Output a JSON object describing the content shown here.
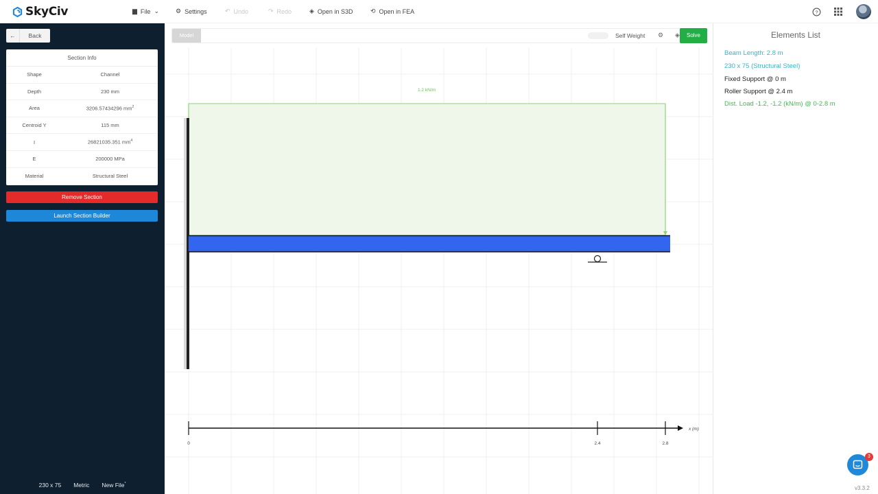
{
  "app": {
    "name": "SkyCiv",
    "version": "v3.3.2"
  },
  "topbar": {
    "file": "File",
    "settings": "Settings",
    "undo": "Undo",
    "redo": "Redo",
    "open_s3d": "Open in S3D",
    "open_fea": "Open in FEA"
  },
  "sidebar": {
    "back": "Back",
    "section_info_title": "Section Info",
    "rows": [
      {
        "key": "Shape",
        "value": "Channel"
      },
      {
        "key": "Depth",
        "value": "230 mm"
      },
      {
        "key": "Area",
        "value": "3206.57434296 mm",
        "sup": "2"
      },
      {
        "key": "Centroid Y",
        "value": "115 mm"
      },
      {
        "key": "I",
        "value": "26821035.351 mm",
        "sup": "4"
      },
      {
        "key": "E",
        "value": "200000 MPa"
      },
      {
        "key": "Material",
        "value": "Structural Steel"
      }
    ],
    "remove_section": "Remove Section",
    "launch_section_builder": "Launch Section Builder",
    "footer": {
      "section": "230 x 75",
      "units": "Metric",
      "file": "New File",
      "file_mark": "*"
    }
  },
  "toolbar": {
    "model": "Model",
    "self_weight": "Self Weight",
    "solve": "Solve"
  },
  "canvas": {
    "load_label": "1.2 kN/m",
    "axis_label": "x (m)",
    "ticks": [
      "0",
      "2.4",
      "2.8"
    ],
    "beam_color": "#3366ee",
    "load_fill": "#eef7ea",
    "load_stroke": "#8fd27a"
  },
  "elements_list": {
    "title": "Elements List",
    "items": [
      {
        "text": "Beam Length: 2.8 m",
        "color": "#37b5c4"
      },
      {
        "text": "230 x 75 (Structural Steel)",
        "color": "#37b5c4"
      },
      {
        "text": "Fixed Support @ 0 m",
        "color": "#222222"
      },
      {
        "text": "Roller Support @ 2.4 m",
        "color": "#222222"
      },
      {
        "text": "Dist. Load -1.2, -1.2 (kN/m) @ 0-2.8 m",
        "color": "#3fbb52"
      }
    ]
  }
}
